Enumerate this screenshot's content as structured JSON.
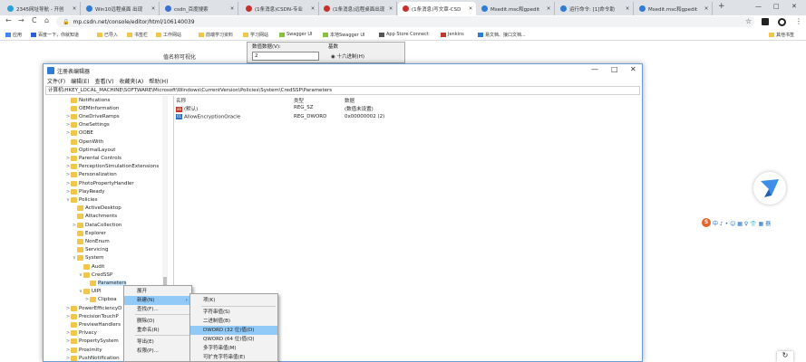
{
  "tabs": [
    {
      "label": "2345网址导航 - 开创",
      "color": "#2b9fd8"
    },
    {
      "label": "Win10远程桌面 出现",
      "color": "#2e7cd6"
    },
    {
      "label": "csdn_百度搜索",
      "color": "#3b6fd8"
    },
    {
      "label": "(1条消息)CSDN-专业",
      "color": "#c9302c"
    },
    {
      "label": "(1条消息)远程桌面出现",
      "color": "#c9302c"
    },
    {
      "label": "(1条消息)写文章-CSD",
      "color": "#c9302c"
    },
    {
      "label": "Msedit.msc和gpedit",
      "color": "#2e7cd6"
    },
    {
      "label": "运行命令: [1]命令助",
      "color": "#2e7cd6"
    },
    {
      "label": "Msedit.msc和gpedit",
      "color": "#2e7cd6"
    }
  ],
  "browser": {
    "url": "mp.csdn.net/console/editor/html/106140039",
    "back": "←",
    "forward": "→",
    "reload": "C",
    "home": "⌂",
    "new_tab": "+",
    "minimize": "—",
    "maximize": "□",
    "close": "✕",
    "star": "☆",
    "menu": "⋮"
  },
  "bookmarks": [
    {
      "label": "应用",
      "color": "#4285f4"
    },
    {
      "label": "百度一下，你就知道",
      "color": "#2b5fd8"
    },
    {
      "label": "已导入",
      "color": "#f2c54b"
    },
    {
      "label": "书签栏",
      "color": "#f2c54b"
    },
    {
      "label": "工作网站",
      "color": "#f2c54b"
    },
    {
      "label": "前端学习资料",
      "color": "#f2c54b"
    },
    {
      "label": "学习网站",
      "color": "#f2c54b"
    },
    {
      "label": "Swagger UI",
      "color": "#85c23a"
    },
    {
      "label": "本地Swagger UI",
      "color": "#85c23a"
    },
    {
      "label": "App Store Connect",
      "color": "#555555"
    },
    {
      "label": "Jenkins",
      "color": "#c0392b"
    },
    {
      "label": "易文档、接口文档...",
      "color": "#2e7cd6"
    },
    {
      "label": "其他书签",
      "color": "#f2c54b"
    }
  ],
  "page": {
    "label_left": "值名称可视化",
    "panel_label1": "数值数据(V):",
    "panel_value": "2",
    "panel_label2": "基数",
    "panel_radio": "◉ 十六进制(H)"
  },
  "ime_bar": {
    "logo": "S",
    "items": "中 ♪ • ☺ ▦ ♀ 👕 ▦ 器"
  },
  "regedit": {
    "title": "注册表编辑器",
    "menus": [
      "文件(F)",
      "编辑(E)",
      "查看(V)",
      "收藏夹(A)",
      "帮助(H)"
    ],
    "path": "计算机\\HKEY_LOCAL_MACHINE\\SOFTWARE\\Microsoft\\Windows\\CurrentVersion\\Policies\\System\\CredSSP\\Parameters",
    "tree": [
      {
        "label": "Notifications",
        "arrow": "",
        "indent": 0
      },
      {
        "label": "OEMInformation",
        "arrow": "",
        "indent": 0
      },
      {
        "label": "OneDriveRamps",
        "arrow": ">",
        "indent": 0
      },
      {
        "label": "OneSettings",
        "arrow": ">",
        "indent": 0
      },
      {
        "label": "OOBE",
        "arrow": ">",
        "indent": 0
      },
      {
        "label": "OpenWith",
        "arrow": "",
        "indent": 0
      },
      {
        "label": "OptimalLayout",
        "arrow": "",
        "indent": 0
      },
      {
        "label": "Parental Controls",
        "arrow": ">",
        "indent": 0
      },
      {
        "label": "PerceptionSimulationExtensions",
        "arrow": ">",
        "indent": 0
      },
      {
        "label": "Personalization",
        "arrow": ">",
        "indent": 0
      },
      {
        "label": "PhotoPropertyHandler",
        "arrow": ">",
        "indent": 0
      },
      {
        "label": "PlayReady",
        "arrow": ">",
        "indent": 0
      },
      {
        "label": "Policies",
        "arrow": "v",
        "indent": 0
      },
      {
        "label": "ActiveDesktop",
        "arrow": "",
        "indent": 1
      },
      {
        "label": "Attachments",
        "arrow": "",
        "indent": 1
      },
      {
        "label": "DataCollection",
        "arrow": ">",
        "indent": 1
      },
      {
        "label": "Explorer",
        "arrow": "",
        "indent": 1
      },
      {
        "label": "NonEnum",
        "arrow": "",
        "indent": 1
      },
      {
        "label": "Servicing",
        "arrow": "",
        "indent": 1
      },
      {
        "label": "System",
        "arrow": "v",
        "indent": 1
      },
      {
        "label": "Audit",
        "arrow": "",
        "indent": 2
      },
      {
        "label": "CredSSP",
        "arrow": "v",
        "indent": 2
      },
      {
        "label": "Parameters",
        "arrow": "",
        "indent": 3
      },
      {
        "label": "UIPI",
        "arrow": "v",
        "indent": 2
      },
      {
        "label": "Clipboa",
        "arrow": ">",
        "indent": 3
      },
      {
        "label": "PowerEfficiencyD",
        "arrow": ">",
        "indent": 0
      },
      {
        "label": "PrecisionTouchP",
        "arrow": ">",
        "indent": 0
      },
      {
        "label": "PreviewHandlers",
        "arrow": "",
        "indent": 0
      },
      {
        "label": "Privacy",
        "arrow": ">",
        "indent": 0
      },
      {
        "label": "PropertySystem",
        "arrow": ">",
        "indent": 0
      },
      {
        "label": "Proximity",
        "arrow": ">",
        "indent": 0
      },
      {
        "label": "PushNotification",
        "arrow": ">",
        "indent": 0
      }
    ],
    "columns": [
      "名称",
      "类型",
      "数据"
    ],
    "values": [
      {
        "name": "(默认)",
        "type": "REG_SZ",
        "data": "(数值未设置)",
        "icon": "ab",
        "icon_color": "#c0392b"
      },
      {
        "name": "AllowEncryptionOracle",
        "type": "REG_DWORD",
        "data": "0x00000002 (2)",
        "icon": "01",
        "icon_color": "#2e6fc7"
      }
    ]
  },
  "context_menu": {
    "items": [
      {
        "label": "展开",
        "submenu": false,
        "highlight": false
      },
      {
        "label": "新建(N)",
        "submenu": true,
        "highlight": true
      },
      {
        "label": "查找(F)...",
        "submenu": false,
        "highlight": false
      },
      {
        "label": "删除(D)",
        "submenu": false,
        "highlight": false
      },
      {
        "label": "重命名(R)",
        "submenu": false,
        "highlight": false
      },
      {
        "label": "导出(E)",
        "submenu": false,
        "highlight": false
      },
      {
        "label": "权限(P)...",
        "submenu": false,
        "highlight": false
      }
    ],
    "submenu_arrow": "›"
  },
  "new_submenu": {
    "items": [
      {
        "label": "项(K)",
        "highlight": false
      },
      {
        "label": "字符串值(S)",
        "highlight": false
      },
      {
        "label": "二进制值(B)",
        "highlight": false
      },
      {
        "label": "DWORD (32 位)值(D)",
        "highlight": true
      },
      {
        "label": "QWORD (64 位)值(Q)",
        "highlight": false
      },
      {
        "label": "多字符串值(M)",
        "highlight": false
      },
      {
        "label": "可扩充字符串值(E)",
        "highlight": false
      }
    ]
  }
}
